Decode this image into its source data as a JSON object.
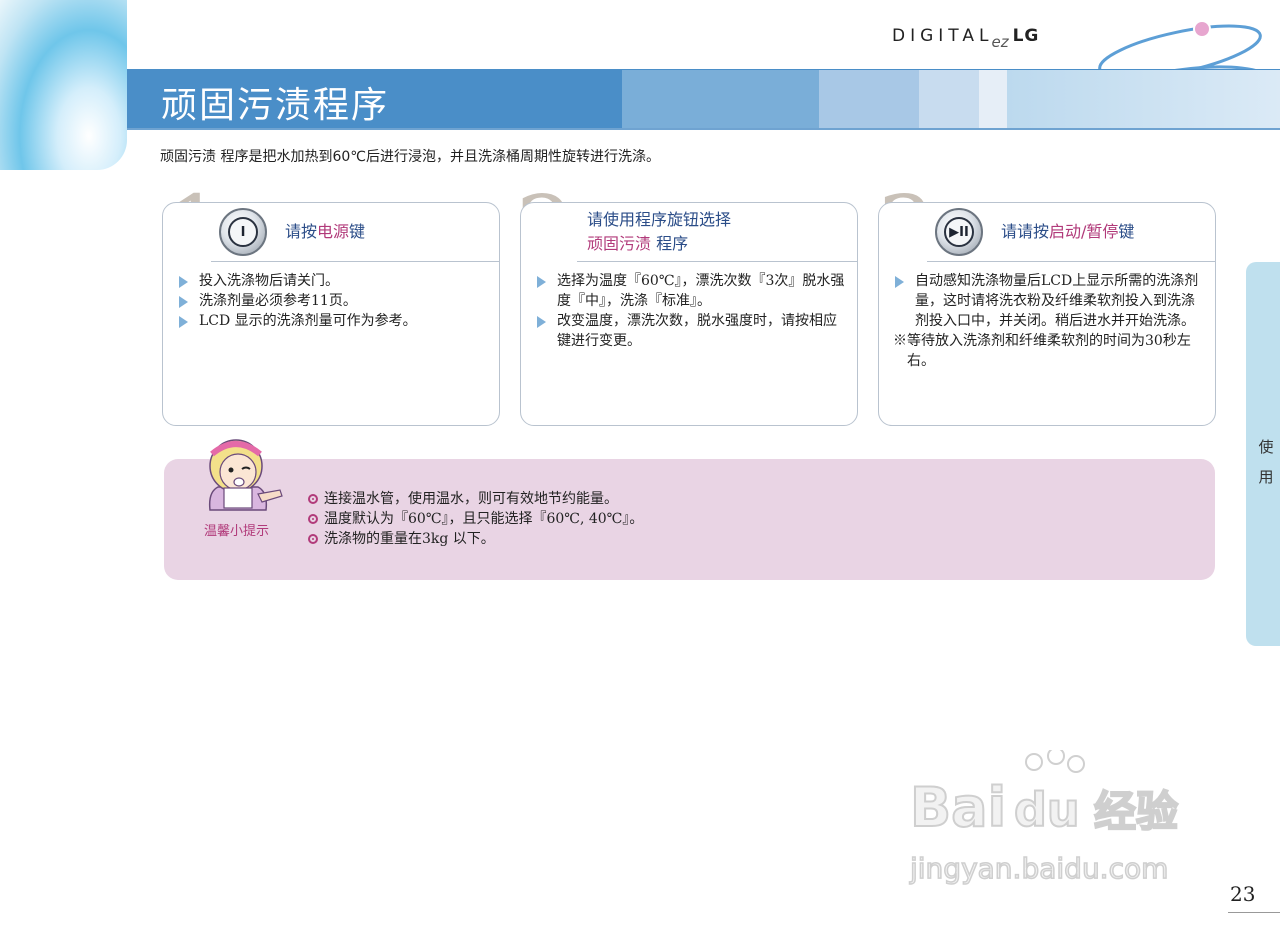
{
  "header": {
    "brand_digital": "DIGITAL",
    "brand_ez": "ez",
    "brand_lg": "LG",
    "title": "顽固污渍程序",
    "intro": "顽固污渍 程序是把水加热到60℃后进行浸泡，并且洗涤桶周期性旋转进行洗涤。"
  },
  "steps": [
    {
      "num": "1",
      "head_a": "请按",
      "head_hl": "电源",
      "head_b": "键",
      "items": [
        "投入洗涤物后请关门。",
        "洗涤剂量必须参考11页。",
        "LCD 显示的洗涤剂量可作为参考。"
      ]
    },
    {
      "num": "2",
      "head_line1": "请使用程序旋钮选择",
      "head_line2_hl": "顽固污渍",
      "head_line2_b": " 程序",
      "items": [
        "选择为温度『60℃』，漂洗次数『3次』脱水强度『中』，洗涤『标准』。",
        "改变温度，漂洗次数，脱水强度时，请按相应键进行变更。"
      ]
    },
    {
      "num": "3",
      "head_a": "请请按",
      "head_hl": "启动/暂停",
      "head_b": "键",
      "items": [
        "自动感知洗涤物量后LCD上显示所需的洗涤剂量，这时请将洗衣粉及纤维柔软剂投入到洗涤剂投入口中，并关闭。稍后进水并开始洗涤。"
      ],
      "note": "※等待放入洗涤剂和纤维柔软剂的时间为30秒左右。"
    }
  ],
  "tip": {
    "label": "温馨小提示",
    "items": [
      "连接温水管，使用温水，则可有效地节约能量。",
      "温度默认为『60℃』，且只能选择『60℃, 40℃』。",
      "洗涤物的重量在3kg 以下。"
    ]
  },
  "side_tab": {
    "text_1": "使",
    "text_2": "用"
  },
  "watermark": {
    "line1": "Bai",
    "line2": "du",
    "line3": "经验",
    "line4": "jingyan.baidu.com"
  },
  "page_number": "23",
  "colors": {
    "title_bar": "#4a8ec8",
    "highlight": "#b13a7a",
    "heading": "#2b4d88",
    "tip_bg": "#e9d4e4"
  }
}
